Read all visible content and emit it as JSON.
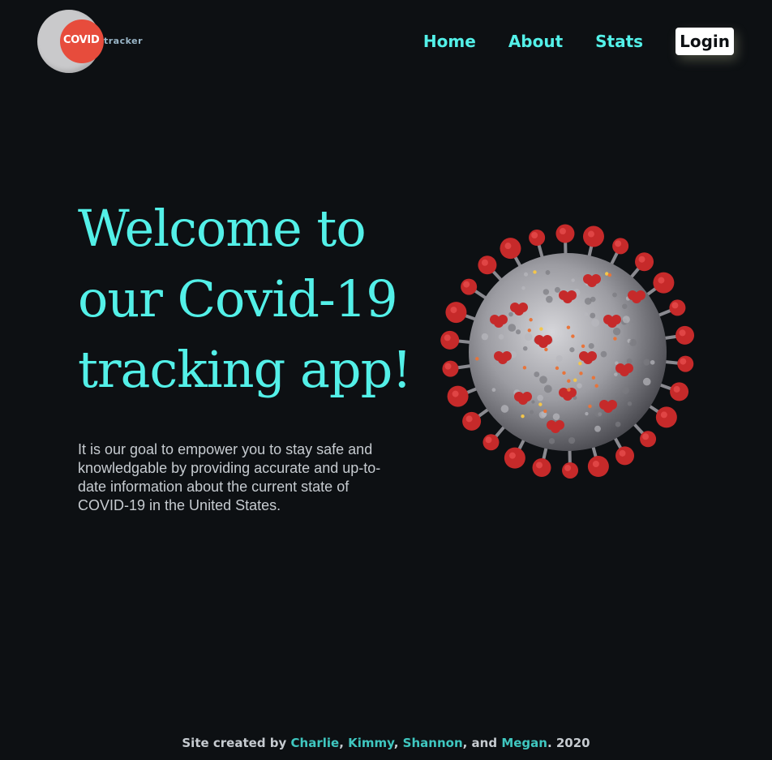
{
  "logo": {
    "word1": "COVID",
    "word2": "tracker"
  },
  "nav": {
    "home": "Home",
    "about": "About",
    "stats": "Stats",
    "login": "Login"
  },
  "hero": {
    "title": "Welcome to our Covid-19 tracking app!",
    "text": "It is our goal to empower you to stay safe and knowledgable by providing accurate and up-to-date information about the current state of COVID-19 in the United States."
  },
  "footer": {
    "prefix": "Site created by ",
    "authors": [
      "Charlie",
      "Kimmy",
      "Shannon",
      "Megan"
    ],
    "sep1": ", ",
    "sep2": ", ",
    "sep3": ", and ",
    "suffix": ". 2020"
  },
  "colors": {
    "accent": "#53f0e8",
    "background": "#0d1013",
    "spike": "#c62a2a",
    "virus_body": "#9a9aa0"
  }
}
